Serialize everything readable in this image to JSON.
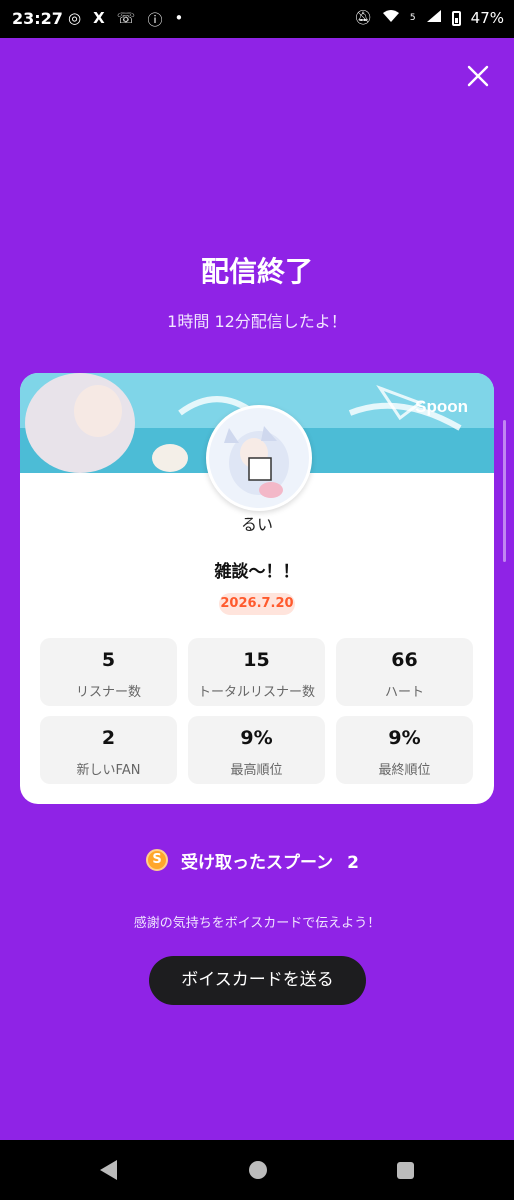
{
  "status_bar": {
    "time": "23:27",
    "battery": "47%",
    "network": "5"
  },
  "title": "配信終了",
  "subtitle": "1時間 12分配信したよ！",
  "card": {
    "banner_logo": "Spoon",
    "username": "るい",
    "broadcast_title": "雑談〜！！",
    "date": "2026.7.20",
    "stats": [
      {
        "value": "5",
        "label": "リスナー数"
      },
      {
        "value": "15",
        "label": "トータルリスナー数"
      },
      {
        "value": "66",
        "label": "ハート"
      },
      {
        "value": "2",
        "label": "新しいFAN"
      },
      {
        "value": "9%",
        "label": "最高順位"
      },
      {
        "value": "9%",
        "label": "最終順位"
      }
    ]
  },
  "spoons": {
    "coin_letter": "S",
    "label": "受け取ったスプーン",
    "count": "2"
  },
  "thanks_text": "感謝の気持ちをボイスカードで伝えよう！",
  "voice_card_button": "ボイスカードを送る",
  "colors": {
    "background": "#8f23e6",
    "date_text": "#ff5a2d",
    "coin": "#ffa62b"
  }
}
